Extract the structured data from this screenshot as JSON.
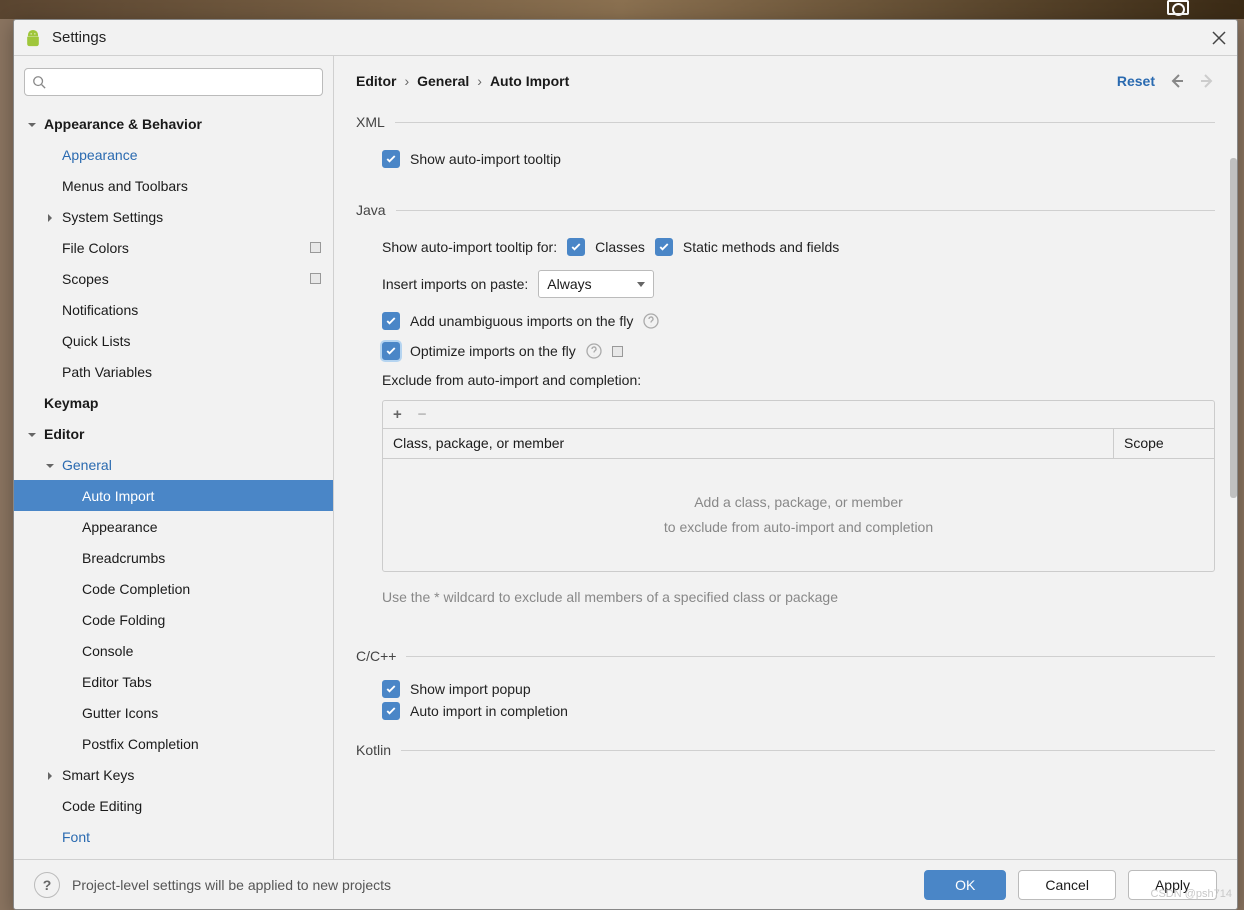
{
  "titlebar": {
    "title": "Settings"
  },
  "sidebar": {
    "search_placeholder": "",
    "items": [
      {
        "label": "Appearance & Behavior",
        "lvl": 0,
        "bold": true,
        "exp": "down"
      },
      {
        "label": "Appearance",
        "lvl": 1,
        "blue": true
      },
      {
        "label": "Menus and Toolbars",
        "lvl": 1
      },
      {
        "label": "System Settings",
        "lvl": 1,
        "sub_exp": "right"
      },
      {
        "label": "File Colors",
        "lvl": 1,
        "pin": true
      },
      {
        "label": "Scopes",
        "lvl": 1,
        "pin": true
      },
      {
        "label": "Notifications",
        "lvl": 1
      },
      {
        "label": "Quick Lists",
        "lvl": 1
      },
      {
        "label": "Path Variables",
        "lvl": 1
      },
      {
        "label": "Keymap",
        "lvl": 0,
        "bold": true
      },
      {
        "label": "Editor",
        "lvl": 0,
        "bold": true,
        "exp": "down"
      },
      {
        "label": "General",
        "lvl": 1,
        "blue": true,
        "sub_exp": "down"
      },
      {
        "label": "Auto Import",
        "lvl": 2,
        "selected": true
      },
      {
        "label": "Appearance",
        "lvl": 2
      },
      {
        "label": "Breadcrumbs",
        "lvl": 2
      },
      {
        "label": "Code Completion",
        "lvl": 2
      },
      {
        "label": "Code Folding",
        "lvl": 2
      },
      {
        "label": "Console",
        "lvl": 2
      },
      {
        "label": "Editor Tabs",
        "lvl": 2
      },
      {
        "label": "Gutter Icons",
        "lvl": 2
      },
      {
        "label": "Postfix Completion",
        "lvl": 2
      },
      {
        "label": "Smart Keys",
        "lvl": 1,
        "sub_exp": "right"
      },
      {
        "label": "Code Editing",
        "lvl": 1
      },
      {
        "label": "Font",
        "lvl": 1,
        "blue": true
      }
    ]
  },
  "breadcrumb": [
    "Editor",
    "General",
    "Auto Import"
  ],
  "reset_label": "Reset",
  "sections": {
    "xml": {
      "title": "XML",
      "show_tooltip": "Show auto-import tooltip"
    },
    "java": {
      "title": "Java",
      "tooltip_for": "Show auto-import tooltip for:",
      "classes": "Classes",
      "static": "Static methods and fields",
      "paste_label": "Insert imports on paste:",
      "paste_value": "Always",
      "add_unambiguous": "Add unambiguous imports on the fly",
      "optimize": "Optimize imports on the fly",
      "exclude_label": "Exclude from auto-import and completion:",
      "col_class": "Class, package, or member",
      "col_scope": "Scope",
      "empty_line1": "Add a class, package, or member",
      "empty_line2": "to exclude from auto-import and completion",
      "hint": "Use the * wildcard to exclude all members of a specified class or package"
    },
    "ccpp": {
      "title": "C/C++",
      "show_popup": "Show import popup",
      "auto_import": "Auto import in completion"
    },
    "kotlin": {
      "title": "Kotlin"
    }
  },
  "footer": {
    "note": "Project-level settings will be applied to new projects",
    "ok": "OK",
    "cancel": "Cancel",
    "apply": "Apply"
  },
  "watermark": "CSDN @psh714"
}
